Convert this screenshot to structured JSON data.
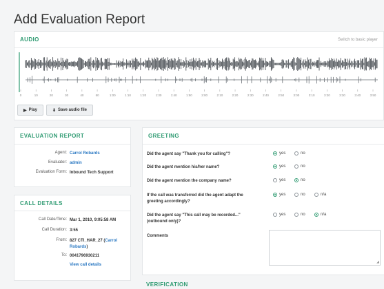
{
  "page": {
    "title": "Add Evaluation Report"
  },
  "audio": {
    "title": "AUDIO",
    "switch_link": "Switch to basic player",
    "timeline": [
      "0",
      "10",
      "20",
      "30",
      "40",
      "50",
      "1:00",
      "1:10",
      "1:20",
      "1:30",
      "1:40",
      "1:50",
      "2:00",
      "2:10",
      "2:20",
      "2:30",
      "2:40",
      "2:50",
      "3:00",
      "3:10",
      "3:20",
      "3:30",
      "3:40",
      "3:50"
    ],
    "play_label": "Play",
    "save_label": "Save audio file"
  },
  "evaluation_report": {
    "title": "EVALUATION REPORT",
    "rows": [
      {
        "key": "Agent:",
        "value": "Carrol Robards"
      },
      {
        "key": "Evaluator:",
        "value": "admin"
      },
      {
        "key": "Evaluation Form:",
        "value": "Inbound Tech Support"
      }
    ]
  },
  "call_details": {
    "title": "CALL DETAILS",
    "date_key": "Call Date/Time:",
    "date_value": "Mar 1, 2010, 9:05:58 AM",
    "duration_key": "Call Duration:",
    "duration_value": "3:55",
    "from_key": "From:",
    "from_value": "827 CTI_HAR_27 (",
    "from_link": "Carrol Robards",
    "from_close": ")",
    "to_key": "To:",
    "to_value": "0041796930211",
    "view_link": "View call details"
  },
  "greeting": {
    "title": "GREETING",
    "questions": [
      {
        "text": "Did the agent say \"Thank you for calling\"?",
        "options": [
          "yes",
          "no"
        ],
        "selected": "yes"
      },
      {
        "text": "Did the agent mention his/her name?",
        "options": [
          "yes",
          "no"
        ],
        "selected": "yes"
      },
      {
        "text": "Did the agent mention the company name?",
        "options": [
          "yes",
          "no"
        ],
        "selected": "no"
      },
      {
        "text": "If the call was transferred did the agent adapt the greeting accordingly?",
        "options": [
          "yes",
          "no",
          "n/a"
        ],
        "selected": "yes"
      },
      {
        "text": "Did the agent say \"This call may be recorded...\" (outbound only)?",
        "options": [
          "yes",
          "no",
          "n/a"
        ],
        "selected": "n/a"
      }
    ],
    "comments_label": "Comments"
  },
  "verification": {
    "title": "VERIFICATION"
  },
  "colors": {
    "accent": "#2f9b72",
    "link": "#2a78c2"
  }
}
